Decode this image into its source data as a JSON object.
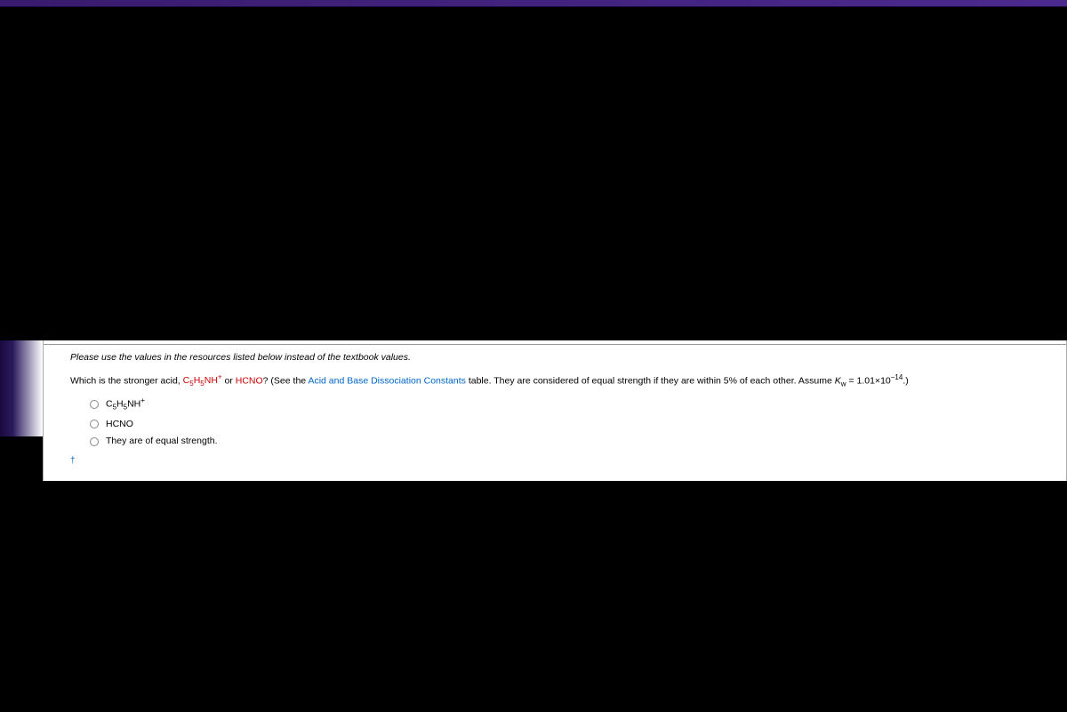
{
  "instruction": "Please use the values in the resources listed below instead of the textbook values.",
  "question": {
    "prefix": "Which is the stronger acid, ",
    "chem1_base": "C",
    "chem1_sub1": "5",
    "chem1_mid": "H",
    "chem1_sub2": "5",
    "chem1_end": "NH",
    "chem1_sup": "+",
    "or_text": " or ",
    "chem2": "HCNO",
    "after_chem": "? (See the ",
    "link_text": "Acid and Base Dissociation Constants",
    "after_link": " table. They are considered of equal strength if they are within 5% of each other. Assume ",
    "kw_var": "K",
    "kw_sub": "w",
    "kw_eq": " = 1.01",
    "kw_times": "×",
    "kw_base": "10",
    "kw_exp": "−14",
    "kw_end": ".)"
  },
  "options": {
    "opt1_base": "C",
    "opt1_sub1": "5",
    "opt1_mid": "H",
    "opt1_sub2": "5",
    "opt1_end": "NH",
    "opt1_sup": "+",
    "opt2": "HCNO",
    "opt3": "They are of equal strength."
  },
  "dagger": "†"
}
